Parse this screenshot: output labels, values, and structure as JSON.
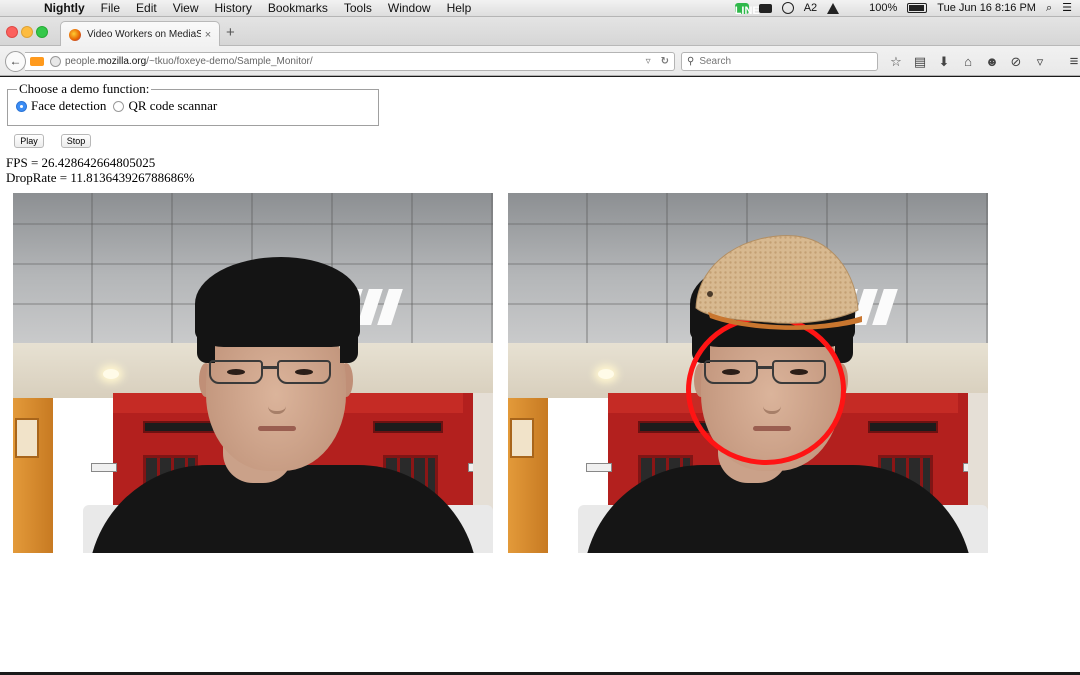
{
  "menubar": {
    "app_name": "Nightly",
    "items": [
      "File",
      "Edit",
      "View",
      "History",
      "Bookmarks",
      "Tools",
      "Window",
      "Help"
    ],
    "status": {
      "line_badge": "LINE",
      "adobe_count": "2",
      "battery": "100%",
      "datetime": "Tue Jun 16  8:16 PM"
    }
  },
  "browser": {
    "tab_title": "Video Workers on MediaStr...",
    "tab_close": "×",
    "new_tab": "+",
    "url_host_prefix": "people.",
    "url_host": "mozilla.org",
    "url_path": "/~tkuo/foxeye-demo/Sample_Monitor/",
    "search_placeholder": "Search",
    "icons": [
      "star-icon",
      "reading-list-icon",
      "download-icon",
      "home-icon",
      "chat-icon",
      "sync-icon",
      "pocket-icon",
      "hamburger-menu-icon"
    ]
  },
  "page": {
    "legend": "Choose a demo function:",
    "options": [
      {
        "label": "Face detection",
        "checked": true
      },
      {
        "label": "QR code scannar",
        "checked": false
      }
    ],
    "play_label": "Play",
    "stop_label": "Stop",
    "fps_text": "FPS = 26.428642664805025",
    "droprate_text": "DropRate = 11.813643926788686%"
  },
  "colors": {
    "detection_circle": "#ff1414",
    "radio_checked": "#3b8df5"
  }
}
